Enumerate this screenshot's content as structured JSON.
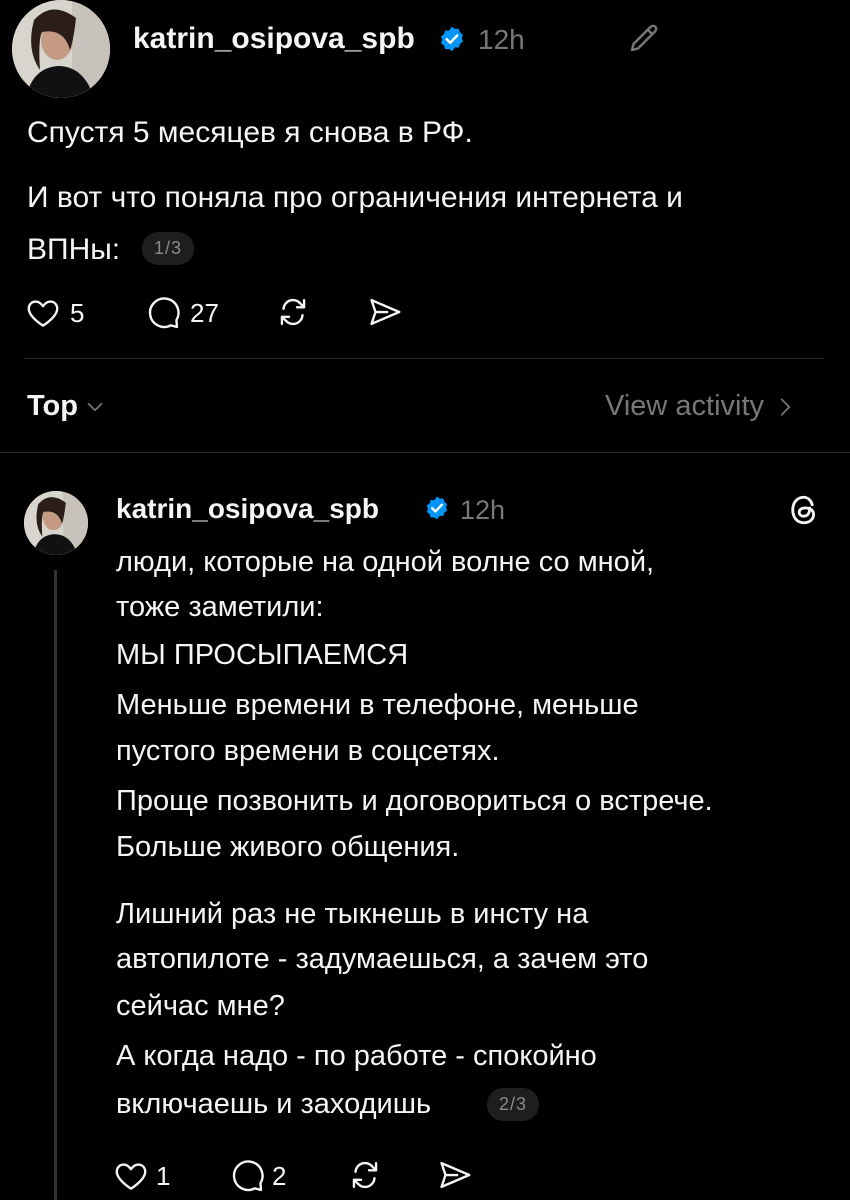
{
  "post1": {
    "username": "katrin_osipova_spb",
    "time": "12h",
    "paragraphs": [
      "Спустя 5 месяцев я снова в РФ.",
      "И вот что поняла про ограничения интернета и",
      "ВПНы:"
    ],
    "badge": "1/3",
    "likes": "5",
    "comments": "27"
  },
  "sort": {
    "label": "Top",
    "view_activity": "View activity"
  },
  "post2": {
    "username": "katrin_osipova_spb",
    "time": "12h",
    "lines": [
      "люди, которые на одной волне со мной,",
      "тоже заметили:",
      "МЫ ПРОСЫПАЕМСЯ",
      "Меньше времени в телефоне, меньше",
      "пустого времени в соцсетях.",
      "Проще позвонить и договориться о встрече.",
      "Больше живого общения.",
      "Лишний раз не тыкнешь в инсту на",
      "автопилоте - задумаешься, а зачем это",
      "сейчас мне?",
      "А когда надо - по работе - спокойно",
      "включаешь и заходишь"
    ],
    "badge": "2/3",
    "likes": "1",
    "comments": "2"
  },
  "icons": {
    "verified": "verified-badge-icon",
    "edit": "pencil-icon",
    "threads": "threads-logo-icon",
    "like": "heart-icon",
    "comment": "comment-icon",
    "repost": "repost-icon",
    "share": "share-icon",
    "chevron": "chevron-right-icon",
    "dropdown": "chevron-down-icon"
  },
  "colors": {
    "background": "#000000",
    "text": "#f3f5f7",
    "muted": "#777777",
    "verified": "#0095f6"
  }
}
